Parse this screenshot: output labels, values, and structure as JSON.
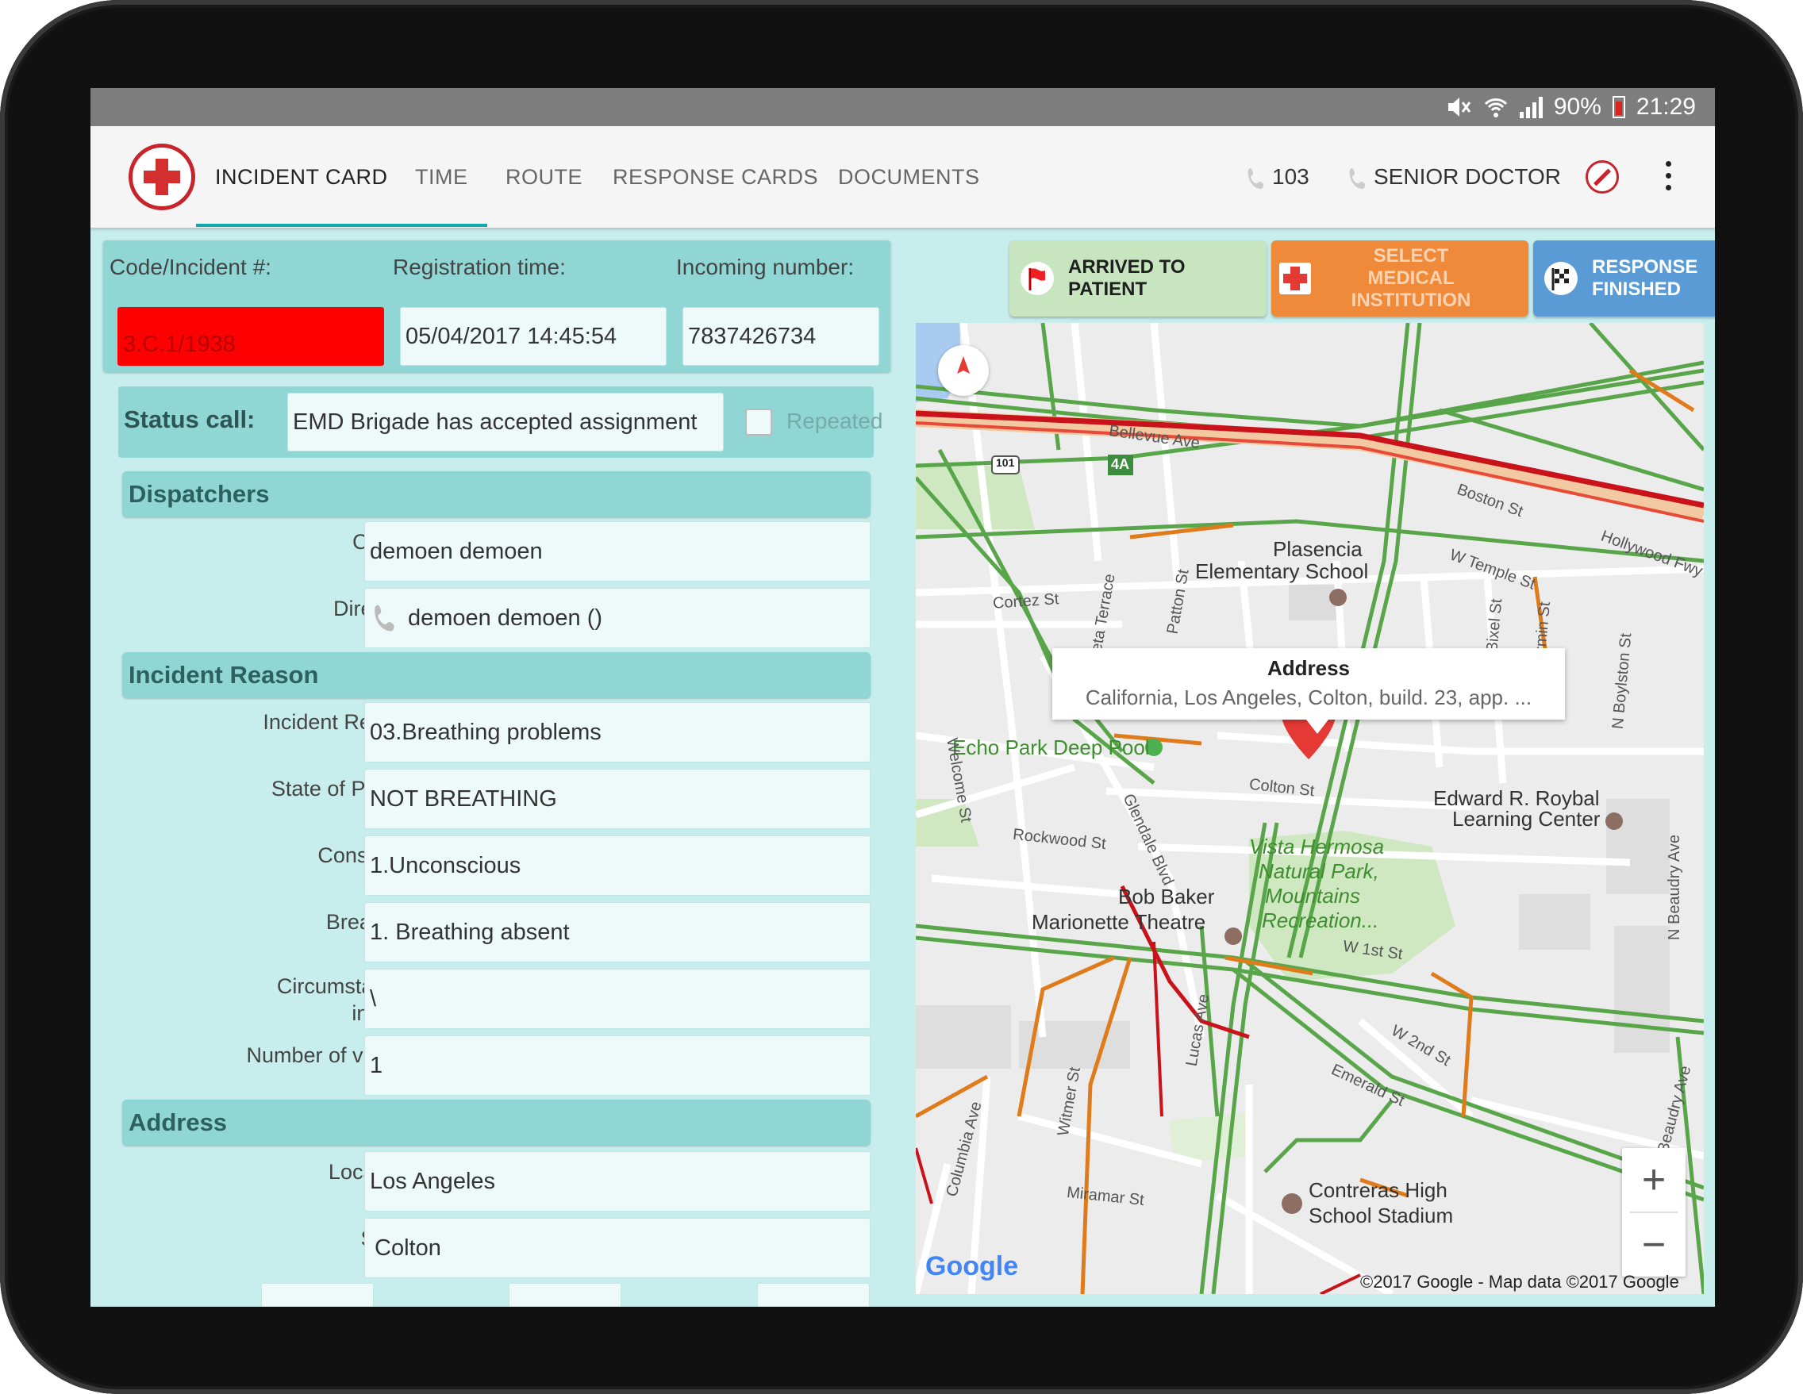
{
  "status_bar": {
    "battery": "90%",
    "time": "21:29"
  },
  "app_bar": {
    "tabs": [
      {
        "label": "INCIDENT CARD",
        "active": true
      },
      {
        "label": "TIME",
        "active": false
      },
      {
        "label": "ROUTE",
        "active": false
      },
      {
        "label": "RESPONSE CARDS",
        "active": false
      },
      {
        "label": "DOCUMENTS",
        "active": false
      }
    ],
    "phone_number": "103",
    "role": "SENIOR DOCTOR"
  },
  "incident": {
    "code_label": "Code/Incident #:",
    "code_value": "3.C.1/1938",
    "reg_time_label": "Registration time:",
    "reg_time_value": "05/04/2017 14:45:54",
    "incoming_label": "Incoming number:",
    "incoming_value": "7837426734",
    "status_label": "Status call:",
    "status_value": "EMD Brigade has accepted assignment",
    "repeated_label": "Repeated"
  },
  "dispatchers": {
    "title": "Dispatchers",
    "calling_label": "Calling:",
    "calling_value": "demoen demoen",
    "direction_label": "Direction:",
    "direction_value": "demoen demoen ()"
  },
  "incident_reason": {
    "title": "Incident Reason",
    "rows": [
      {
        "label": "Incident Reason:",
        "value": "03.Breathing problems"
      },
      {
        "label": "State of Patient:",
        "value": "NOT BREATHING"
      },
      {
        "label": "Conscious:",
        "value": "1.Unconscious"
      },
      {
        "label": "Breathing:",
        "value": "1. Breathing absent"
      },
      {
        "label": "Circumstance of incident:",
        "value": "\\"
      },
      {
        "label": "Number of victims:",
        "value": "1"
      }
    ]
  },
  "address": {
    "title": "Address",
    "localities_label": "Localities:",
    "localities_value": "Los Angeles",
    "street_label": "Street:",
    "street_value": "Colton"
  },
  "actions": {
    "arrived": "ARRIVED TO PATIENT",
    "select_medical": "SELECT MEDICAL INSTITUTION",
    "finished": "RESPONSE FINISHED"
  },
  "map": {
    "info_title": "Address",
    "info_text": "California, Los Angeles,  Colton, build. 23, app. ...",
    "labels": {
      "bellevue": "Bellevue Ave",
      "route101": "101",
      "exit4a": "4A",
      "boston": "Boston St",
      "hollywood": "Hollywood Fwy",
      "w_temple": "W Temple St",
      "plasencia": "Plasencia",
      "elementary": "Elementary School",
      "cortez": "Cortez St",
      "laveta": "Laveta Terrace",
      "patton": "Patton St",
      "bixel": "N Bixel St",
      "firmin": "Firmin St",
      "boylston": "N Boylston St",
      "echo_pool": "Echo Park Deep Pool",
      "welcome": "Welcome St",
      "colton": "Colton St",
      "royba1": "Edward R. Roybal",
      "royba2": "Learning Center",
      "rockwood": "Rockwood St",
      "glendale": "Glendale Blvd",
      "vista1": "Vista Hermosa",
      "vista2": "Natural Park,",
      "vista3": "Mountains",
      "vista4": "Recreation...",
      "bob1": "Bob Baker",
      "bob2": "Marionette Theatre",
      "w1st": "W 1st St",
      "beaudry": "N Beaudry Ave",
      "w2nd": "W 2nd St",
      "emerald": "Emerald St",
      "lucas": "Lucas Ave",
      "witmer": "Witmer St",
      "columbia": "Columbia Ave",
      "miramar": "Miramar St",
      "contreras1": "Contreras High",
      "contreras2": "School Stadium",
      "beaudry2": "Beaudry Ave",
      "google": "Google",
      "copyright": "©2017 Google - Map data ©2017 Google"
    },
    "zoom_in": "+",
    "zoom_out": "−"
  },
  "colors": {
    "panel": "#8fd6d4",
    "background": "#c8eded",
    "arrived_btn": "#c7e6c0",
    "select_btn": "#ef8a3a",
    "finished_btn": "#5b9bd5",
    "code_highlight": "#ff0000"
  }
}
